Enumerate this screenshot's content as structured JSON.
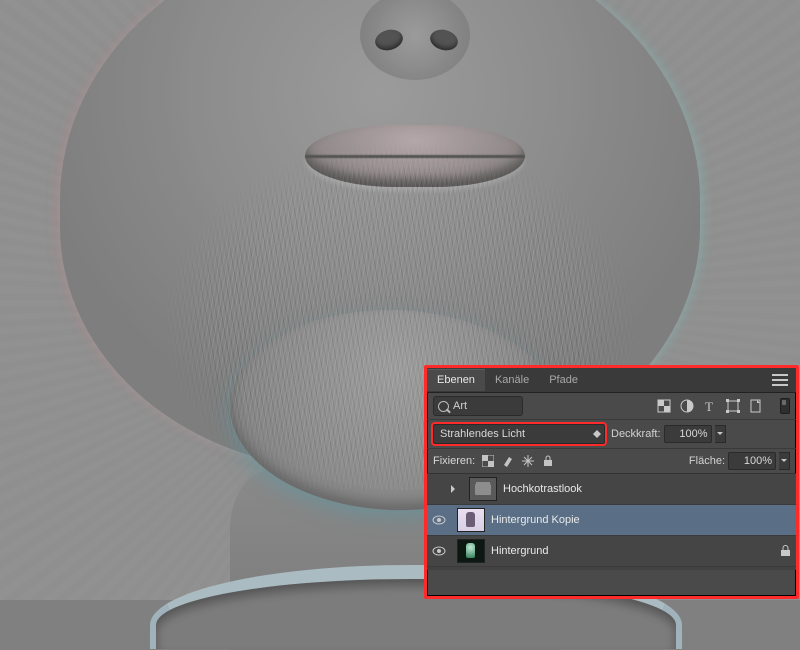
{
  "panel": {
    "tabs": {
      "layers": "Ebenen",
      "channels": "Kanäle",
      "paths": "Pfade"
    },
    "filter_label": "Art",
    "blend_mode": "Strahlendes Licht",
    "opacity_label": "Deckkraft:",
    "opacity_value": "100%",
    "lock_label": "Fixieren:",
    "fill_label": "Fläche:",
    "fill_value": "100%",
    "layers": [
      {
        "name": "Hochkotrastlook",
        "type": "group",
        "visible": false,
        "selected": false
      },
      {
        "name": "Hintergrund Kopie",
        "type": "photo",
        "visible": true,
        "selected": true
      },
      {
        "name": "Hintergrund",
        "type": "dark",
        "visible": true,
        "selected": false,
        "locked": true
      }
    ]
  }
}
